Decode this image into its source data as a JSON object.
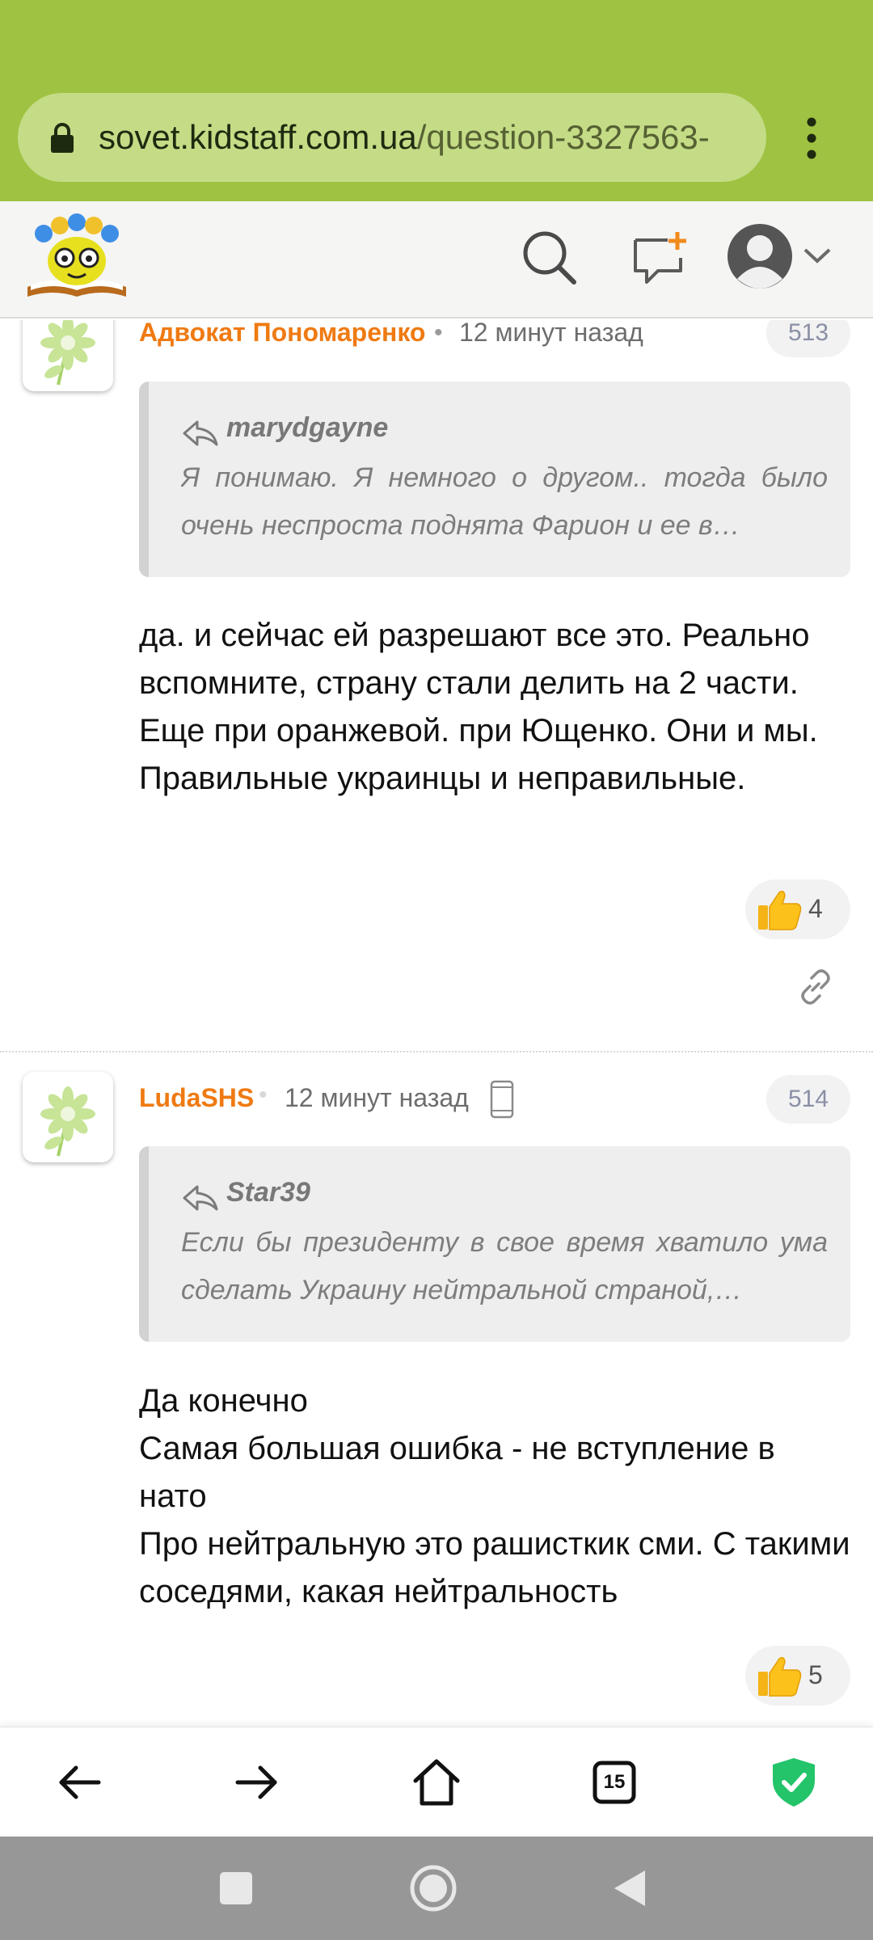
{
  "browser": {
    "url_domain": "sovet.kidstaff.com.ua",
    "url_path": "/question-3327563-",
    "tabs_count": "15",
    "colors": {
      "toolbar": "#9fc242",
      "shield": "#23c46a"
    }
  },
  "comments": [
    {
      "author": "Адвокат Пономаренко",
      "separator": "•",
      "time": "12 минут назад",
      "number": "513",
      "quote_author": "marydgayne",
      "quote_text": "Я понимаю. Я немного о другом.. тогда было очень неспроста поднята Фарион и ее в…",
      "body": "да. и сейчас ей разрешают все это. Реально вспомните, страну стали делить на 2 части. Еще при оранжевой. при Ющенко. Они и мы. Правильные украинцы и неправильные.",
      "likes": "4"
    },
    {
      "author": "LudaSHS",
      "separator": "•",
      "time": "12 минут назад",
      "number": "514",
      "quote_author": "Star39",
      "quote_text": "Если бы президенту в свое время хватило ума сделать Украину нейтральной страной,…",
      "body": "Да конечно\nСамая большая ошибка - не вступление в нато\nПро нейтральную это рашисткик сми. С такими соседями, какая нейтральность",
      "likes": "5"
    }
  ],
  "icons": {
    "header": [
      "search-icon",
      "new-question-icon",
      "user-avatar-icon",
      "chevron-down-icon"
    ],
    "bottom_bar": [
      "back-arrow-icon",
      "forward-arrow-icon",
      "home-icon",
      "tabs-icon",
      "shield-check-icon"
    ],
    "nav_bar": [
      "recents-square-icon",
      "home-circle-icon",
      "back-triangle-icon"
    ]
  }
}
